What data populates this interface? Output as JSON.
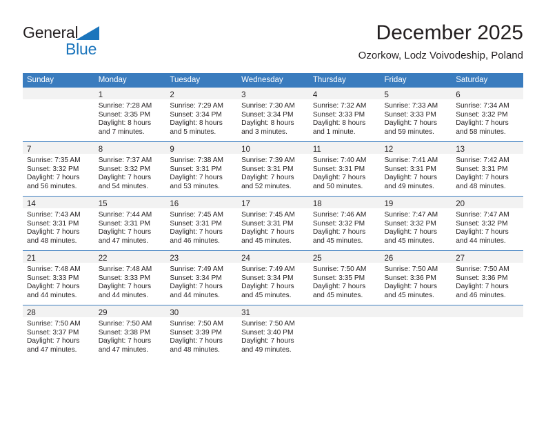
{
  "brand": {
    "name_top": "General",
    "name_bottom": "Blue",
    "accent_color": "#1b75bc",
    "triangle_icon": "triangle-icon"
  },
  "header": {
    "title": "December 2025",
    "subtitle": "Ozorkow, Lodz Voivodeship, Poland"
  },
  "theme": {
    "header_row_bg": "#3a7cbe",
    "header_row_text": "#ffffff",
    "daynum_band_bg": "#f2f2f2",
    "week_divider": "#3a7cbe",
    "text": "#231f20"
  },
  "calendar": {
    "weekday_headers": [
      "Sunday",
      "Monday",
      "Tuesday",
      "Wednesday",
      "Thursday",
      "Friday",
      "Saturday"
    ],
    "weeks": [
      [
        {
          "day": "",
          "lines": []
        },
        {
          "day": "1",
          "lines": [
            "Sunrise: 7:28 AM",
            "Sunset: 3:35 PM",
            "Daylight: 8 hours",
            "and 7 minutes."
          ]
        },
        {
          "day": "2",
          "lines": [
            "Sunrise: 7:29 AM",
            "Sunset: 3:34 PM",
            "Daylight: 8 hours",
            "and 5 minutes."
          ]
        },
        {
          "day": "3",
          "lines": [
            "Sunrise: 7:30 AM",
            "Sunset: 3:34 PM",
            "Daylight: 8 hours",
            "and 3 minutes."
          ]
        },
        {
          "day": "4",
          "lines": [
            "Sunrise: 7:32 AM",
            "Sunset: 3:33 PM",
            "Daylight: 8 hours",
            "and 1 minute."
          ]
        },
        {
          "day": "5",
          "lines": [
            "Sunrise: 7:33 AM",
            "Sunset: 3:33 PM",
            "Daylight: 7 hours",
            "and 59 minutes."
          ]
        },
        {
          "day": "6",
          "lines": [
            "Sunrise: 7:34 AM",
            "Sunset: 3:32 PM",
            "Daylight: 7 hours",
            "and 58 minutes."
          ]
        }
      ],
      [
        {
          "day": "7",
          "lines": [
            "Sunrise: 7:35 AM",
            "Sunset: 3:32 PM",
            "Daylight: 7 hours",
            "and 56 minutes."
          ]
        },
        {
          "day": "8",
          "lines": [
            "Sunrise: 7:37 AM",
            "Sunset: 3:32 PM",
            "Daylight: 7 hours",
            "and 54 minutes."
          ]
        },
        {
          "day": "9",
          "lines": [
            "Sunrise: 7:38 AM",
            "Sunset: 3:31 PM",
            "Daylight: 7 hours",
            "and 53 minutes."
          ]
        },
        {
          "day": "10",
          "lines": [
            "Sunrise: 7:39 AM",
            "Sunset: 3:31 PM",
            "Daylight: 7 hours",
            "and 52 minutes."
          ]
        },
        {
          "day": "11",
          "lines": [
            "Sunrise: 7:40 AM",
            "Sunset: 3:31 PM",
            "Daylight: 7 hours",
            "and 50 minutes."
          ]
        },
        {
          "day": "12",
          "lines": [
            "Sunrise: 7:41 AM",
            "Sunset: 3:31 PM",
            "Daylight: 7 hours",
            "and 49 minutes."
          ]
        },
        {
          "day": "13",
          "lines": [
            "Sunrise: 7:42 AM",
            "Sunset: 3:31 PM",
            "Daylight: 7 hours",
            "and 48 minutes."
          ]
        }
      ],
      [
        {
          "day": "14",
          "lines": [
            "Sunrise: 7:43 AM",
            "Sunset: 3:31 PM",
            "Daylight: 7 hours",
            "and 48 minutes."
          ]
        },
        {
          "day": "15",
          "lines": [
            "Sunrise: 7:44 AM",
            "Sunset: 3:31 PM",
            "Daylight: 7 hours",
            "and 47 minutes."
          ]
        },
        {
          "day": "16",
          "lines": [
            "Sunrise: 7:45 AM",
            "Sunset: 3:31 PM",
            "Daylight: 7 hours",
            "and 46 minutes."
          ]
        },
        {
          "day": "17",
          "lines": [
            "Sunrise: 7:45 AM",
            "Sunset: 3:31 PM",
            "Daylight: 7 hours",
            "and 45 minutes."
          ]
        },
        {
          "day": "18",
          "lines": [
            "Sunrise: 7:46 AM",
            "Sunset: 3:32 PM",
            "Daylight: 7 hours",
            "and 45 minutes."
          ]
        },
        {
          "day": "19",
          "lines": [
            "Sunrise: 7:47 AM",
            "Sunset: 3:32 PM",
            "Daylight: 7 hours",
            "and 45 minutes."
          ]
        },
        {
          "day": "20",
          "lines": [
            "Sunrise: 7:47 AM",
            "Sunset: 3:32 PM",
            "Daylight: 7 hours",
            "and 44 minutes."
          ]
        }
      ],
      [
        {
          "day": "21",
          "lines": [
            "Sunrise: 7:48 AM",
            "Sunset: 3:33 PM",
            "Daylight: 7 hours",
            "and 44 minutes."
          ]
        },
        {
          "day": "22",
          "lines": [
            "Sunrise: 7:48 AM",
            "Sunset: 3:33 PM",
            "Daylight: 7 hours",
            "and 44 minutes."
          ]
        },
        {
          "day": "23",
          "lines": [
            "Sunrise: 7:49 AM",
            "Sunset: 3:34 PM",
            "Daylight: 7 hours",
            "and 44 minutes."
          ]
        },
        {
          "day": "24",
          "lines": [
            "Sunrise: 7:49 AM",
            "Sunset: 3:34 PM",
            "Daylight: 7 hours",
            "and 45 minutes."
          ]
        },
        {
          "day": "25",
          "lines": [
            "Sunrise: 7:50 AM",
            "Sunset: 3:35 PM",
            "Daylight: 7 hours",
            "and 45 minutes."
          ]
        },
        {
          "day": "26",
          "lines": [
            "Sunrise: 7:50 AM",
            "Sunset: 3:36 PM",
            "Daylight: 7 hours",
            "and 45 minutes."
          ]
        },
        {
          "day": "27",
          "lines": [
            "Sunrise: 7:50 AM",
            "Sunset: 3:36 PM",
            "Daylight: 7 hours",
            "and 46 minutes."
          ]
        }
      ],
      [
        {
          "day": "28",
          "lines": [
            "Sunrise: 7:50 AM",
            "Sunset: 3:37 PM",
            "Daylight: 7 hours",
            "and 47 minutes."
          ]
        },
        {
          "day": "29",
          "lines": [
            "Sunrise: 7:50 AM",
            "Sunset: 3:38 PM",
            "Daylight: 7 hours",
            "and 47 minutes."
          ]
        },
        {
          "day": "30",
          "lines": [
            "Sunrise: 7:50 AM",
            "Sunset: 3:39 PM",
            "Daylight: 7 hours",
            "and 48 minutes."
          ]
        },
        {
          "day": "31",
          "lines": [
            "Sunrise: 7:50 AM",
            "Sunset: 3:40 PM",
            "Daylight: 7 hours",
            "and 49 minutes."
          ]
        },
        {
          "day": "",
          "lines": []
        },
        {
          "day": "",
          "lines": []
        },
        {
          "day": "",
          "lines": []
        }
      ]
    ]
  }
}
